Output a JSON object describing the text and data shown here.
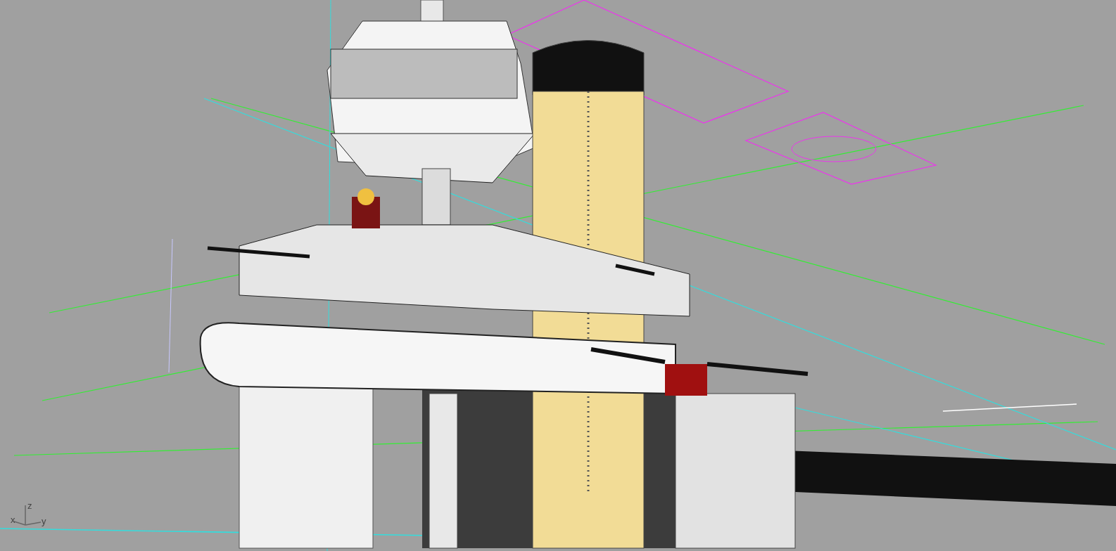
{
  "viewport": {
    "axis_labels": {
      "x": "x",
      "y": "y",
      "z": "z"
    }
  }
}
